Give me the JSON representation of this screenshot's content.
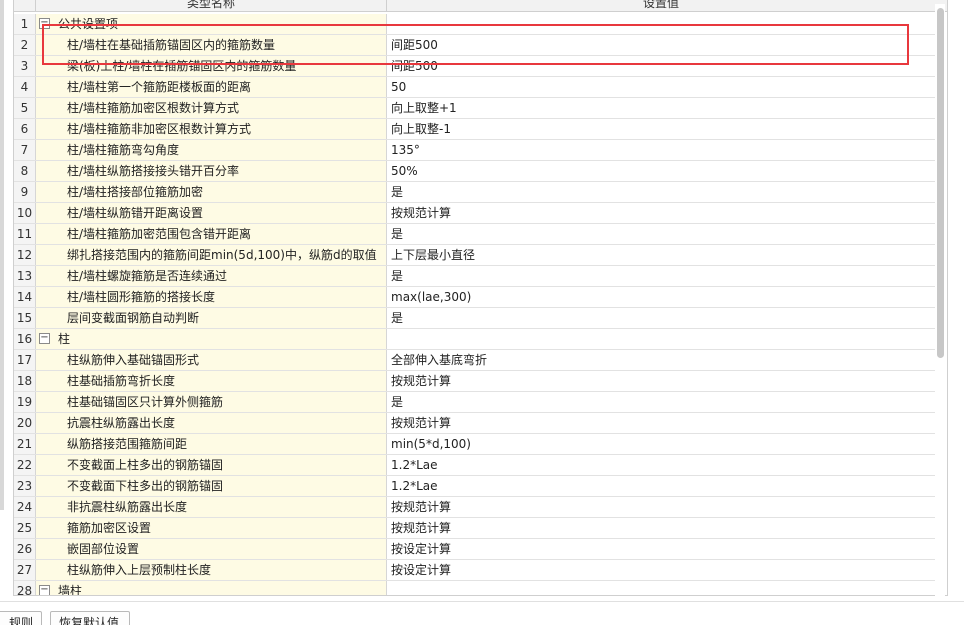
{
  "header": {
    "col_name": "类型名称",
    "col_value": "设置值"
  },
  "rows": [
    {
      "num": "1",
      "group": true,
      "name": "公共设置项",
      "value": ""
    },
    {
      "num": "2",
      "group": false,
      "name": "柱/墙柱在基础插筋锚固区内的箍筋数量",
      "value": "间距500"
    },
    {
      "num": "3",
      "group": false,
      "name": "梁(板)上柱/墙柱在插筋锚固区内的箍筋数量",
      "value": "间距500"
    },
    {
      "num": "4",
      "group": false,
      "name": "柱/墙柱第一个箍筋距楼板面的距离",
      "value": "50"
    },
    {
      "num": "5",
      "group": false,
      "name": "柱/墙柱箍筋加密区根数计算方式",
      "value": "向上取整+1"
    },
    {
      "num": "6",
      "group": false,
      "name": "柱/墙柱箍筋非加密区根数计算方式",
      "value": "向上取整-1"
    },
    {
      "num": "7",
      "group": false,
      "name": "柱/墙柱箍筋弯勾角度",
      "value": "135°"
    },
    {
      "num": "8",
      "group": false,
      "name": "柱/墙柱纵筋搭接接头错开百分率",
      "value": "50%"
    },
    {
      "num": "9",
      "group": false,
      "name": "柱/墙柱搭接部位箍筋加密",
      "value": "是"
    },
    {
      "num": "10",
      "group": false,
      "name": "柱/墙柱纵筋错开距离设置",
      "value": "按规范计算"
    },
    {
      "num": "11",
      "group": false,
      "name": "柱/墙柱箍筋加密范围包含错开距离",
      "value": "是"
    },
    {
      "num": "12",
      "group": false,
      "name": "绑扎搭接范围内的箍筋间距min(5d,100)中，纵筋d的取值",
      "value": "上下层最小直径"
    },
    {
      "num": "13",
      "group": false,
      "name": "柱/墙柱螺旋箍筋是否连续通过",
      "value": "是"
    },
    {
      "num": "14",
      "group": false,
      "name": "柱/墙柱圆形箍筋的搭接长度",
      "value": "max(lae,300)"
    },
    {
      "num": "15",
      "group": false,
      "name": "层间变截面钢筋自动判断",
      "value": "是"
    },
    {
      "num": "16",
      "group": true,
      "name": "柱",
      "value": ""
    },
    {
      "num": "17",
      "group": false,
      "name": "柱纵筋伸入基础锚固形式",
      "value": "全部伸入基底弯折"
    },
    {
      "num": "18",
      "group": false,
      "name": "柱基础插筋弯折长度",
      "value": "按规范计算"
    },
    {
      "num": "19",
      "group": false,
      "name": "柱基础锚固区只计算外侧箍筋",
      "value": "是"
    },
    {
      "num": "20",
      "group": false,
      "name": "抗震柱纵筋露出长度",
      "value": "按规范计算"
    },
    {
      "num": "21",
      "group": false,
      "name": "纵筋搭接范围箍筋间距",
      "value": "min(5*d,100)"
    },
    {
      "num": "22",
      "group": false,
      "name": "不变截面上柱多出的钢筋锚固",
      "value": "1.2*Lae"
    },
    {
      "num": "23",
      "group": false,
      "name": "不变截面下柱多出的钢筋锚固",
      "value": "1.2*Lae"
    },
    {
      "num": "24",
      "group": false,
      "name": "非抗震柱纵筋露出长度",
      "value": "按规范计算"
    },
    {
      "num": "25",
      "group": false,
      "name": "箍筋加密区设置",
      "value": "按规范计算"
    },
    {
      "num": "26",
      "group": false,
      "name": "嵌固部位设置",
      "value": "按设定计算"
    },
    {
      "num": "27",
      "group": false,
      "name": "柱纵筋伸入上层预制柱长度",
      "value": "按设定计算"
    },
    {
      "num": "28",
      "group": true,
      "name": "墙柱",
      "value": ""
    }
  ],
  "toggle_symbol": "−",
  "buttons": {
    "rule_label": "规则",
    "reset_label": "恢复默认值"
  },
  "colors": {
    "highlight": "#e8383d",
    "name_cell_bg": "#fefbe4"
  }
}
